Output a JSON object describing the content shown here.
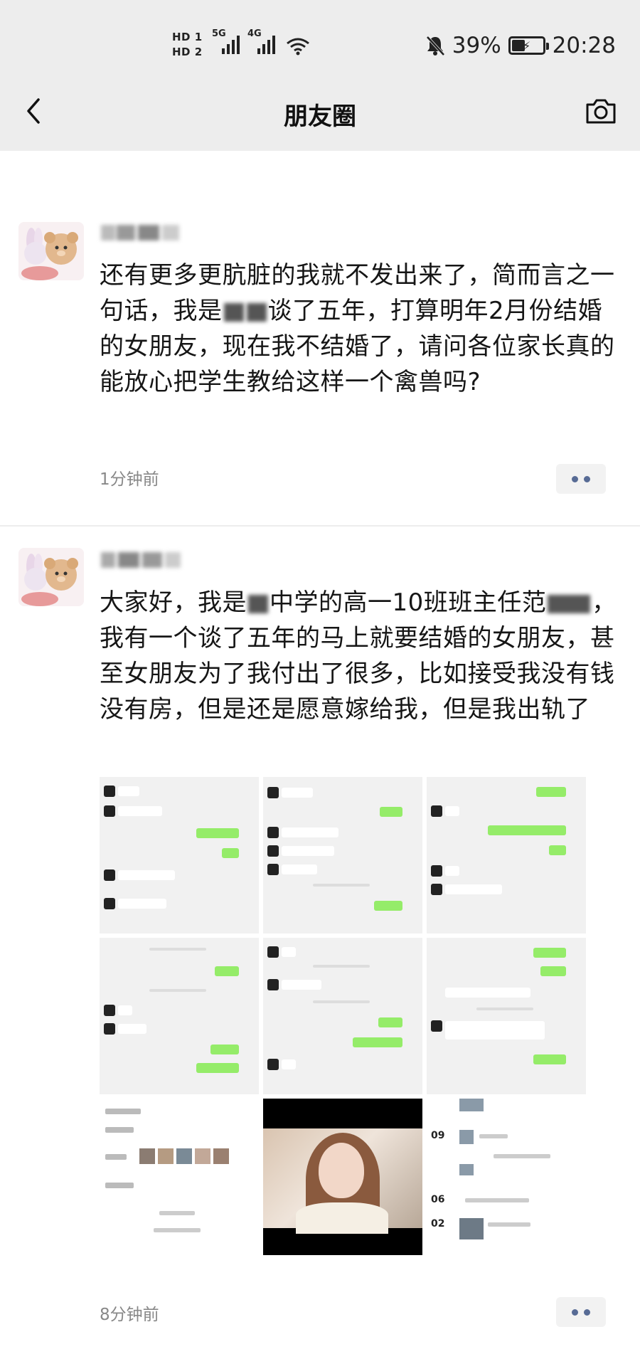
{
  "status_bar": {
    "sim1": "HD 1",
    "sim2": "HD 2",
    "signal1": "5G",
    "signal2": "4G",
    "battery": "39%",
    "time": "20:28",
    "icons": [
      "mute-icon",
      "wifi-icon",
      "battery-charging-icon"
    ]
  },
  "nav": {
    "title": "朋友圈",
    "back_icon": "chevron-left-icon",
    "camera_icon": "camera-icon"
  },
  "posts": [
    {
      "text_a": "还有更多更肮脏的我就不发出来了，简而言之一句话，我是",
      "text_b": "谈了五年，打算明年2月份结婚的女朋友，现在我不结婚了，请问各位家长真的能放心把学生教给这样一个禽兽吗?",
      "time": "1分钟前",
      "more_icon": "more-dots-icon"
    },
    {
      "text_a": "大家好，我是",
      "text_b": "中学的高一10班班主任范",
      "text_c": "， 我有一个谈了五年的马上就要结婚的女朋友，甚至女朋友为了我付出了很多，比如接受我没有钱没有房，但是还是愿意嫁给我，但是我出轨了",
      "time": "8分钟前",
      "more_icon": "more-dots-icon",
      "images": [
        "chat-screenshot-1",
        "chat-screenshot-2",
        "chat-screenshot-3",
        "chat-screenshot-4",
        "chat-screenshot-5",
        "chat-screenshot-6",
        "profile-settings-screenshot",
        "video-screenshot",
        "moments-feed-screenshot"
      ],
      "moments_dates": [
        "09",
        "06",
        "02"
      ]
    }
  ],
  "colors": {
    "header_bg": "#ededed",
    "link_blue": "#576b95",
    "chat_green": "#95ec69"
  }
}
